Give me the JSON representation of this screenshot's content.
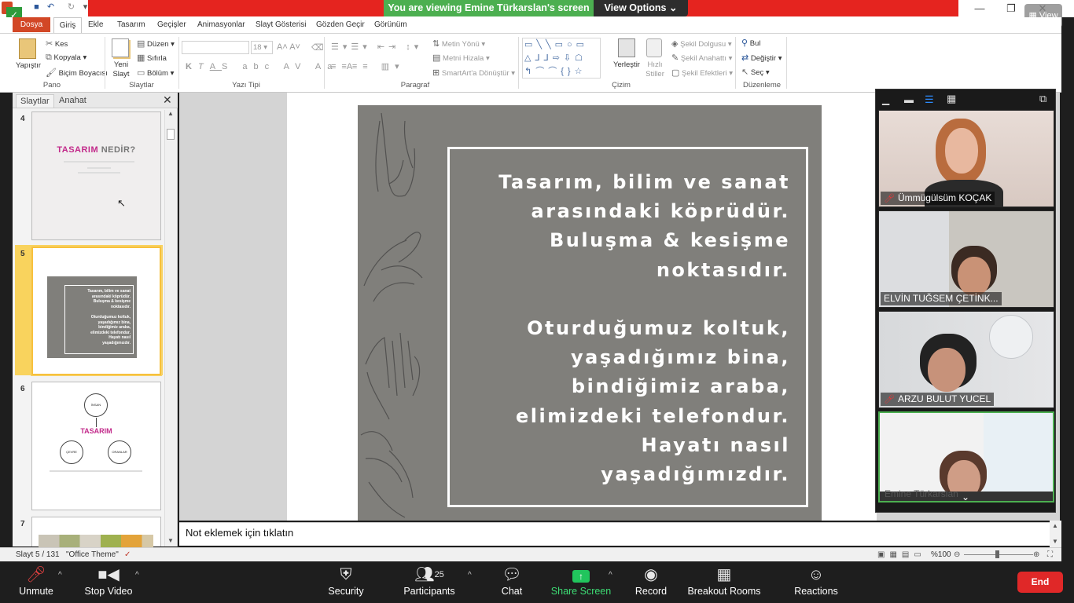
{
  "zoom": {
    "banner": "You are viewing Emine Türkarslan's screen",
    "view_options": "View Options",
    "view_button": "View",
    "toolbar": {
      "unmute": "Unmute",
      "stop_video": "Stop Video",
      "security": "Security",
      "participants": "Participants",
      "participants_count": "25",
      "chat": "Chat",
      "share_screen": "Share Screen",
      "record": "Record",
      "breakout_rooms": "Breakout Rooms",
      "reactions": "Reactions",
      "end": "End"
    },
    "participants": [
      {
        "name": "Ümmügülsüm KOÇAK",
        "muted": true
      },
      {
        "name": "ELVİN TUĞSEM ÇETİNK...",
        "muted": false
      },
      {
        "name": "ARZU BULUT YUCEL",
        "muted": true
      },
      {
        "name": "Emine Türkarslan",
        "muted": false
      }
    ]
  },
  "ppt": {
    "tabs": [
      "Dosya",
      "Giriş",
      "Ekle",
      "Tasarım",
      "Geçişler",
      "Animasyonlar",
      "Slayt Gösterisi",
      "Gözden Geçir",
      "Görünüm"
    ],
    "ribbon": {
      "pano": {
        "label": "Pano",
        "paste": "Yapıştır",
        "cut": "Kes",
        "copy": "Kopyala",
        "format_painter": "Biçim Boyacısı"
      },
      "slaytlar": {
        "label": "Slaytlar",
        "new_slide": "Yeni Slayt",
        "layout": "Düzen",
        "reset": "Sıfırla",
        "section": "Bölüm"
      },
      "yazi_tipi": {
        "label": "Yazı Tipi",
        "font_size": "18"
      },
      "paragraf": {
        "label": "Paragraf",
        "text_direction": "Metin Yönü",
        "align_text": "Metni Hizala",
        "smartart": "SmartArt'a Dönüştür"
      },
      "cizim": {
        "label": "Çizim",
        "arrange": "Yerleştir",
        "quick_styles": "Hızlı Stiller",
        "shape_fill": "Şekil Dolgusu",
        "shape_outline": "Şekil Anahattı",
        "shape_effects": "Şekil Efektleri"
      },
      "duzenleme": {
        "label": "Düzenleme",
        "find": "Bul",
        "replace": "Değiştir",
        "select": "Seç"
      }
    },
    "panel_tabs": [
      "Slaytlar",
      "Anahat"
    ],
    "thumbnails": [
      {
        "number": "4",
        "title_a": "TASARIM",
        "title_b": " NEDİR?"
      },
      {
        "number": "5",
        "lines": [
          "Tasarım, bilim ve sanat",
          "arasındaki köprüdür.",
          "Buluşma & kesişme",
          "noktasıdır.",
          "",
          "Oturduğumuz koltuk,",
          "yaşadığımız bina,",
          "bindiğimiz araba,",
          "elimizdeki telefondur.",
          "Hayatı nasıl",
          "yaşadığımızdır."
        ]
      },
      {
        "number": "6",
        "center": "TASARIM",
        "nodes": [
          "İNSAN",
          "ÇEVRE",
          "ORANLAR"
        ]
      },
      {
        "number": "7"
      }
    ],
    "slide_text": {
      "p1": [
        "Tasarım, bilim ve sanat",
        "arasındaki köprüdür.",
        "Buluşma & kesişme",
        "noktasıdır."
      ],
      "p2": [
        "Oturduğumuz koltuk,",
        "yaşadığımız bina,",
        "bindiğimiz araba,",
        "elimizdeki telefondur.",
        "Hayatı nasıl",
        "yaşadığımızdır."
      ]
    },
    "notes_placeholder": "Not eklemek için tıklatın",
    "status": {
      "slide": "Slayt 5 / 131",
      "theme": "\"Office Theme\"",
      "zoom": "%100"
    }
  },
  "colors": {
    "zoom_red": "#e5241f",
    "zoom_green": "#4caf50",
    "ppt_orange": "#d24726",
    "selection": "#f7c13c",
    "slide_bg": "#807f7b",
    "title_pink": "#c2298a"
  }
}
